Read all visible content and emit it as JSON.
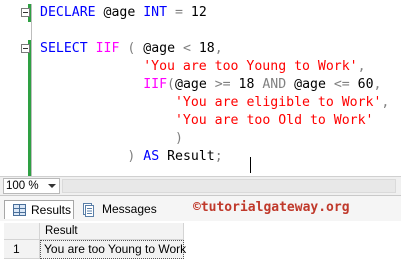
{
  "editor": {
    "lines": [
      [
        {
          "t": "DECLARE",
          "c": "kw"
        },
        {
          "t": " @age ",
          "c": "id"
        },
        {
          "t": "INT",
          "c": "kw"
        },
        {
          "t": " ",
          "c": "id"
        },
        {
          "t": "=",
          "c": "op"
        },
        {
          "t": " 12",
          "c": "id"
        }
      ],
      [],
      [
        {
          "t": "SELECT",
          "c": "kw"
        },
        {
          "t": " ",
          "c": "id"
        },
        {
          "t": "IIF",
          "c": "fn"
        },
        {
          "t": " ",
          "c": "id"
        },
        {
          "t": "(",
          "c": "op"
        },
        {
          "t": " @age ",
          "c": "id"
        },
        {
          "t": "<",
          "c": "op"
        },
        {
          "t": " 18",
          "c": "id"
        },
        {
          "t": ",",
          "c": "op"
        }
      ],
      [
        {
          "t": "             ",
          "c": "id"
        },
        {
          "t": "'You are too Young to Work'",
          "c": "str"
        },
        {
          "t": ",",
          "c": "op"
        }
      ],
      [
        {
          "t": "             ",
          "c": "id"
        },
        {
          "t": "IIF",
          "c": "fn"
        },
        {
          "t": "(",
          "c": "op"
        },
        {
          "t": "@age ",
          "c": "id"
        },
        {
          "t": ">=",
          "c": "op"
        },
        {
          "t": " 18 ",
          "c": "id"
        },
        {
          "t": "AND",
          "c": "op"
        },
        {
          "t": " @age ",
          "c": "id"
        },
        {
          "t": "<=",
          "c": "op"
        },
        {
          "t": " 60",
          "c": "id"
        },
        {
          "t": ",",
          "c": "op"
        }
      ],
      [
        {
          "t": "                 ",
          "c": "id"
        },
        {
          "t": "'You are eligible to Work'",
          "c": "str"
        },
        {
          "t": ",",
          "c": "op"
        }
      ],
      [
        {
          "t": "                 ",
          "c": "id"
        },
        {
          "t": "'You are too Old to Work'",
          "c": "str"
        }
      ],
      [
        {
          "t": "                 ",
          "c": "id"
        },
        {
          "t": ")",
          "c": "op"
        }
      ],
      [
        {
          "t": "           ",
          "c": "id"
        },
        {
          "t": ")",
          "c": "op"
        },
        {
          "t": " ",
          "c": "id"
        },
        {
          "t": "AS",
          "c": "kw"
        },
        {
          "t": " Result",
          "c": "id"
        },
        {
          "t": ";",
          "c": "op"
        }
      ]
    ]
  },
  "status": {
    "zoom": "100 %"
  },
  "results": {
    "tabs": {
      "results_label": "Results",
      "messages_label": "Messages"
    },
    "watermark": "©tutorialgateway.org",
    "grid": {
      "column_header": "Result",
      "rows": [
        {
          "row_number": "1",
          "value": "You are too Young to Work"
        }
      ]
    }
  },
  "icons": {
    "results_tab_icon": "results-grid-icon",
    "messages_tab_icon": "messages-document-icon"
  }
}
